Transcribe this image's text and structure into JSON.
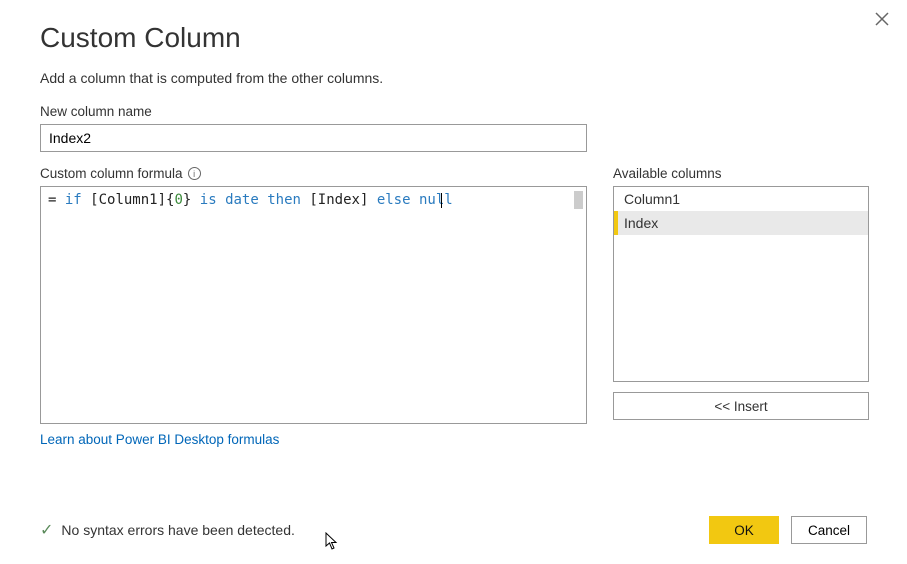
{
  "dialog": {
    "title": "Custom Column",
    "subtitle": "Add a column that is computed from the other columns.",
    "name_label": "New column name",
    "name_value": "Index2",
    "formula_label": "Custom column formula",
    "link_text": "Learn about Power BI Desktop formulas",
    "status_text": "No syntax errors have been detected.",
    "ok_label": "OK",
    "cancel_label": "Cancel"
  },
  "formula": {
    "prefix": "= ",
    "t_if": "if",
    "t_sp1": " ",
    "t_col1": "[Column1]",
    "t_brace_open": "{",
    "t_zero": "0",
    "t_brace_close": "}",
    "t_sp2": " ",
    "t_is": "is",
    "t_sp3": " ",
    "t_date": "date",
    "t_sp4": " ",
    "t_then": "then",
    "t_sp5": " ",
    "t_index": "[Index]",
    "t_sp6": " ",
    "t_else": "else",
    "t_sp7": " ",
    "t_nul": "nul",
    "t_l": "l"
  },
  "available": {
    "label": "Available columns",
    "items": [
      {
        "label": "Column1",
        "selected": false
      },
      {
        "label": "Index",
        "selected": true
      }
    ],
    "insert_label": "<< Insert"
  }
}
